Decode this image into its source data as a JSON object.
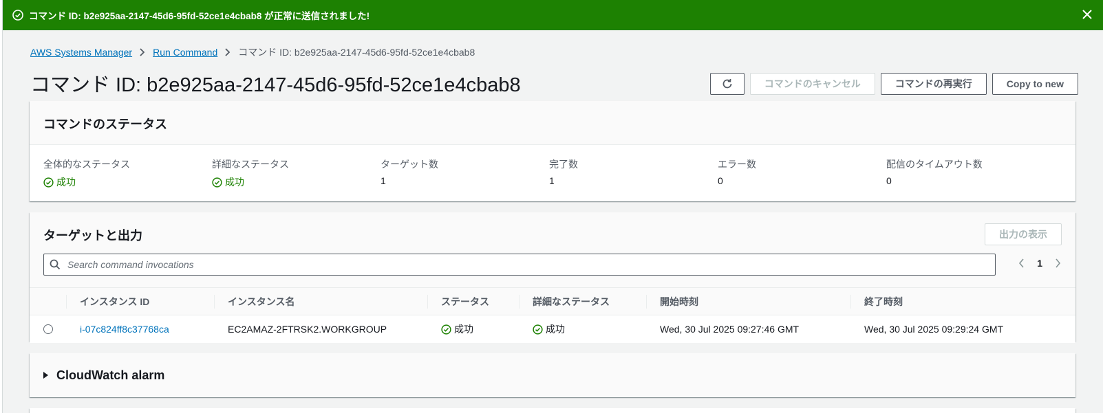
{
  "flash": {
    "message": "コマンド ID: b2e925aa-2147-45d6-95fd-52ce1e4cbab8 が正常に送信されました!",
    "color": "#1d8102"
  },
  "breadcrumb": {
    "items": [
      "AWS Systems Manager",
      "Run Command"
    ],
    "current": "コマンド ID: b2e925aa-2147-45d6-95fd-52ce1e4cbab8"
  },
  "page": {
    "title": "コマンド ID: b2e925aa-2147-45d6-95fd-52ce1e4cbab8"
  },
  "actions": {
    "refresh_icon": "refresh-icon",
    "cancel": "コマンドのキャンセル",
    "rerun": "コマンドの再実行",
    "copy": "Copy to new"
  },
  "status_panel": {
    "title": "コマンドのステータス",
    "fields": [
      {
        "label": "全体的なステータス",
        "value": "成功",
        "ok": true
      },
      {
        "label": "詳細なステータス",
        "value": "成功",
        "ok": true
      },
      {
        "label": "ターゲット数",
        "value": "1"
      },
      {
        "label": "完了数",
        "value": "1"
      },
      {
        "label": "エラー数",
        "value": "0"
      },
      {
        "label": "配信のタイムアウト数",
        "value": "0"
      }
    ]
  },
  "targets_panel": {
    "title": "ターゲットと出力",
    "output_button": "出力の表示",
    "search_placeholder": "Search command invocations",
    "page": "1",
    "columns": [
      "インスタンス ID",
      "インスタンス名",
      "ステータス",
      "詳細なステータス",
      "開始時刻",
      "終了時刻"
    ],
    "rows": [
      {
        "instance_id": "i-07c824ff8c37768ca",
        "instance_name": "EC2AMAZ-2FTRSK2.WORKGROUP",
        "status": "成功",
        "detailed_status": "成功",
        "start": "Wed, 30 Jul 2025 09:27:46 GMT",
        "end": "Wed, 30 Jul 2025 09:29:24 GMT"
      }
    ]
  },
  "cloudwatch": {
    "title": "CloudWatch alarm"
  }
}
